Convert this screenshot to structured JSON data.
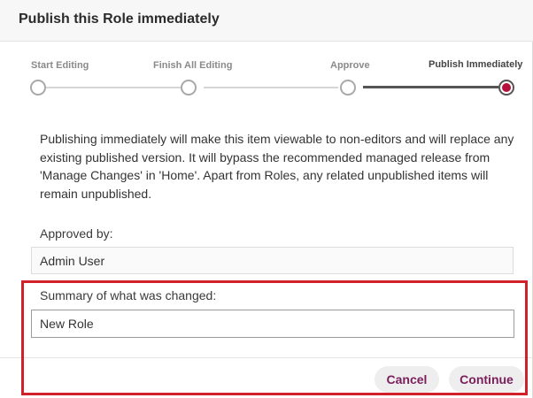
{
  "dialog": {
    "title": "Publish this Role immediately"
  },
  "stepper": {
    "steps": [
      {
        "label": "Start Editing",
        "state": "done"
      },
      {
        "label": "Finish All Editing",
        "state": "done"
      },
      {
        "label": "Approve",
        "state": "done"
      },
      {
        "label": "Publish Immediately",
        "state": "current"
      }
    ],
    "active_color": "#b5103a"
  },
  "description": "Publishing immediately will make this item viewable to non-editors and will replace any existing published version. It will bypass the recommended managed release from 'Manage Changes' in 'Home'. Apart from Roles, any related unpublished items will remain unpublished.",
  "approved_by": {
    "label": "Approved by:",
    "value": "Admin User"
  },
  "summary": {
    "label": "Summary of what was changed:",
    "value": "New Role"
  },
  "footer": {
    "cancel_label": "Cancel",
    "continue_label": "Continue",
    "button_text_color": "#7a1f5b"
  },
  "highlight_color": "#d0202a"
}
